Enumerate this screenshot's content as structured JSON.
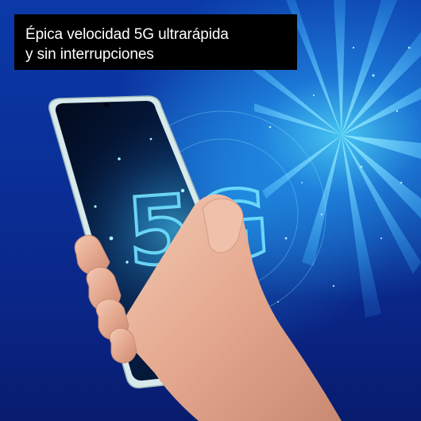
{
  "banner": {
    "line1": "Épica velocidad 5G ultrarápida",
    "line2": "y sin interrupciones"
  },
  "screen": {
    "network_label": "5G"
  },
  "colors": {
    "background_deep": "#0a2585",
    "background_glow": "#50dcff",
    "banner_bg": "#000000",
    "banner_text": "#ffffff",
    "phone_frame": "#cfe3e6",
    "screen_glow": "#4fd7ff"
  }
}
